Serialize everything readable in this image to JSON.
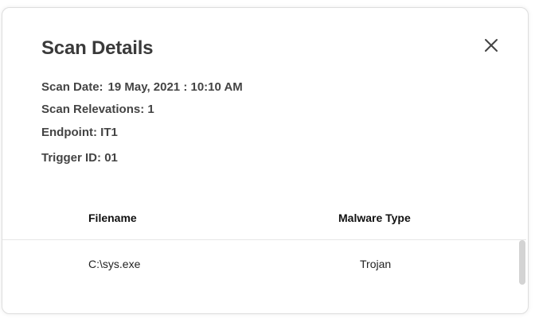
{
  "modal": {
    "title": "Scan Details",
    "close_icon": "close-icon",
    "scan_date_label": "Scan Date:",
    "scan_date_value": "19 May, 2021 : 10:10 AM",
    "scan_relevations_label": "Scan Relevations:",
    "scan_relevations_value": "1",
    "endpoint_label": "Endpoint:",
    "endpoint_value": "IT1",
    "trigger_id_label": "Trigger ID:",
    "trigger_id_value": "01"
  },
  "table": {
    "columns": [
      "Filename",
      "Malware Type"
    ],
    "rows": [
      [
        "C:\\sys.exe",
        "Trojan"
      ]
    ]
  }
}
